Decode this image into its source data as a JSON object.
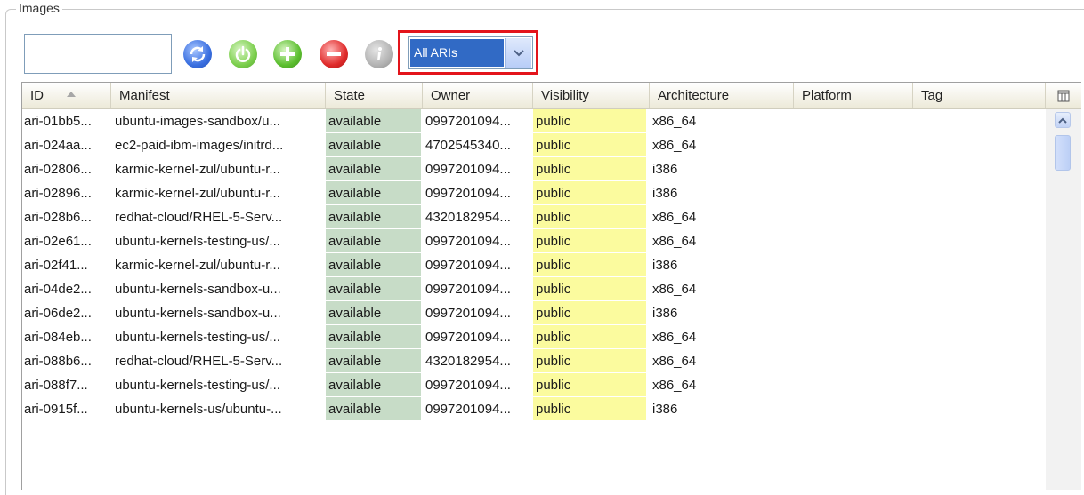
{
  "panel": {
    "title": "Images"
  },
  "search": {
    "value": "",
    "placeholder": ""
  },
  "toolbar": {
    "buttons": [
      {
        "name": "refresh",
        "icon": "refresh-icon"
      },
      {
        "name": "power",
        "icon": "power-icon"
      },
      {
        "name": "add",
        "icon": "plus-icon"
      },
      {
        "name": "remove",
        "icon": "minus-icon"
      },
      {
        "name": "info",
        "icon": "info-icon"
      }
    ],
    "filter": {
      "selected": "All ARIs",
      "highlight_color": "#e3141b"
    }
  },
  "table": {
    "columns": [
      "ID",
      "Manifest",
      "State",
      "Owner",
      "Visibility",
      "Architecture",
      "Platform",
      "Tag"
    ],
    "sorted_column": "ID",
    "rows": [
      {
        "id": "ari-01bb5...",
        "manifest": "ubuntu-images-sandbox/u...",
        "state": "available",
        "owner": "0997201094...",
        "visibility": "public",
        "architecture": "x86_64"
      },
      {
        "id": "ari-024aa...",
        "manifest": "ec2-paid-ibm-images/initrd...",
        "state": "available",
        "owner": "4702545340...",
        "visibility": "public",
        "architecture": "x86_64"
      },
      {
        "id": "ari-02806...",
        "manifest": "karmic-kernel-zul/ubuntu-r...",
        "state": "available",
        "owner": "0997201094...",
        "visibility": "public",
        "architecture": "i386"
      },
      {
        "id": "ari-02896...",
        "manifest": "karmic-kernel-zul/ubuntu-r...",
        "state": "available",
        "owner": "0997201094...",
        "visibility": "public",
        "architecture": "i386"
      },
      {
        "id": "ari-028b6...",
        "manifest": "redhat-cloud/RHEL-5-Serv...",
        "state": "available",
        "owner": "4320182954...",
        "visibility": "public",
        "architecture": "x86_64"
      },
      {
        "id": "ari-02e61...",
        "manifest": "ubuntu-kernels-testing-us/...",
        "state": "available",
        "owner": "0997201094...",
        "visibility": "public",
        "architecture": "x86_64"
      },
      {
        "id": "ari-02f41...",
        "manifest": "karmic-kernel-zul/ubuntu-r...",
        "state": "available",
        "owner": "0997201094...",
        "visibility": "public",
        "architecture": "i386"
      },
      {
        "id": "ari-04de2...",
        "manifest": "ubuntu-kernels-sandbox-u...",
        "state": "available",
        "owner": "0997201094...",
        "visibility": "public",
        "architecture": "x86_64"
      },
      {
        "id": "ari-06de2...",
        "manifest": "ubuntu-kernels-sandbox-u...",
        "state": "available",
        "owner": "0997201094...",
        "visibility": "public",
        "architecture": "i386"
      },
      {
        "id": "ari-084eb...",
        "manifest": "ubuntu-kernels-testing-us/...",
        "state": "available",
        "owner": "0997201094...",
        "visibility": "public",
        "architecture": "x86_64"
      },
      {
        "id": "ari-088b6...",
        "manifest": "redhat-cloud/RHEL-5-Serv...",
        "state": "available",
        "owner": "4320182954...",
        "visibility": "public",
        "architecture": "x86_64"
      },
      {
        "id": "ari-088f7...",
        "manifest": "ubuntu-kernels-testing-us/...",
        "state": "available",
        "owner": "0997201094...",
        "visibility": "public",
        "architecture": "x86_64"
      },
      {
        "id": "ari-0915f...",
        "manifest": "ubuntu-kernels-us/ubuntu-...",
        "state": "available",
        "owner": "0997201094...",
        "visibility": "public",
        "architecture": "i386"
      }
    ]
  },
  "colors": {
    "state_cell": "#c7dcc7",
    "visibility_cell": "#fbfb9e",
    "selection": "#316ac5"
  }
}
